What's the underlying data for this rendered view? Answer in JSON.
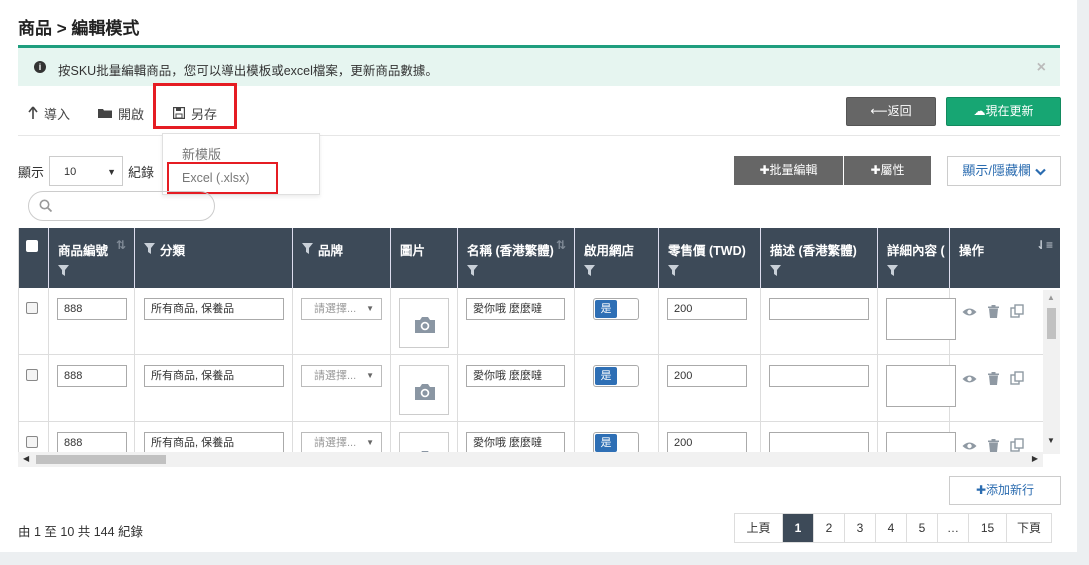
{
  "page": {
    "title": "商品 > 編輯模式"
  },
  "alert": {
    "message": "按SKU批量編輯商品，您可以導出模板或excel檔案，更新商品數據。",
    "close": "×"
  },
  "toolbar": {
    "import_label": "導入",
    "open_label": "開啟",
    "saveas_label": "另存",
    "back_label": "返回",
    "update_label": "現在更新"
  },
  "saveas_menu": {
    "items": [
      "新模版",
      "Excel (.xlsx)"
    ]
  },
  "length_control": {
    "show_label": "顯示",
    "value": "10",
    "records_label": "紀錄"
  },
  "buttons": {
    "batch_edit": "批量編輯",
    "attributes": "屬性",
    "show_hide_cols": "顯示/隱藏欄"
  },
  "table": {
    "columns": [
      "商品編號",
      "分類",
      "品牌",
      "圖片",
      "名稱 (香港繁體)",
      "啟用網店",
      "零售價 (TWD)",
      "描述 (香港繁體)",
      "詳細內容 (",
      "操作"
    ],
    "rows": [
      {
        "sku": "888",
        "category": "所有商品, 保養品",
        "brand_placeholder": "請選擇...",
        "name": "愛你哦 麼麼噠",
        "enabled": "是",
        "price": "200",
        "desc": ""
      },
      {
        "sku": "888",
        "category": "所有商品, 保養品",
        "brand_placeholder": "請選擇...",
        "name": "愛你哦 麼麼噠",
        "enabled": "是",
        "price": "200",
        "desc": ""
      },
      {
        "sku": "888",
        "category": "所有商品, 保養品",
        "brand_placeholder": "請選擇...",
        "name": "愛你哦 麼麼噠",
        "enabled": "是",
        "price": "200",
        "desc": ""
      }
    ]
  },
  "add_row_label": "添加新行",
  "info": "由 1 至 10 共 144 紀錄",
  "pagination": {
    "prev": "上頁",
    "pages": [
      "1",
      "2",
      "3",
      "4",
      "5",
      "…",
      "15"
    ],
    "next": "下頁",
    "active": "1"
  },
  "colors": {
    "header_bg": "#3d4a58",
    "accent_green": "#17a673",
    "alert_border": "#1e9e7e",
    "link_blue": "#2b6cb0",
    "highlight_red": "#e51c23"
  }
}
